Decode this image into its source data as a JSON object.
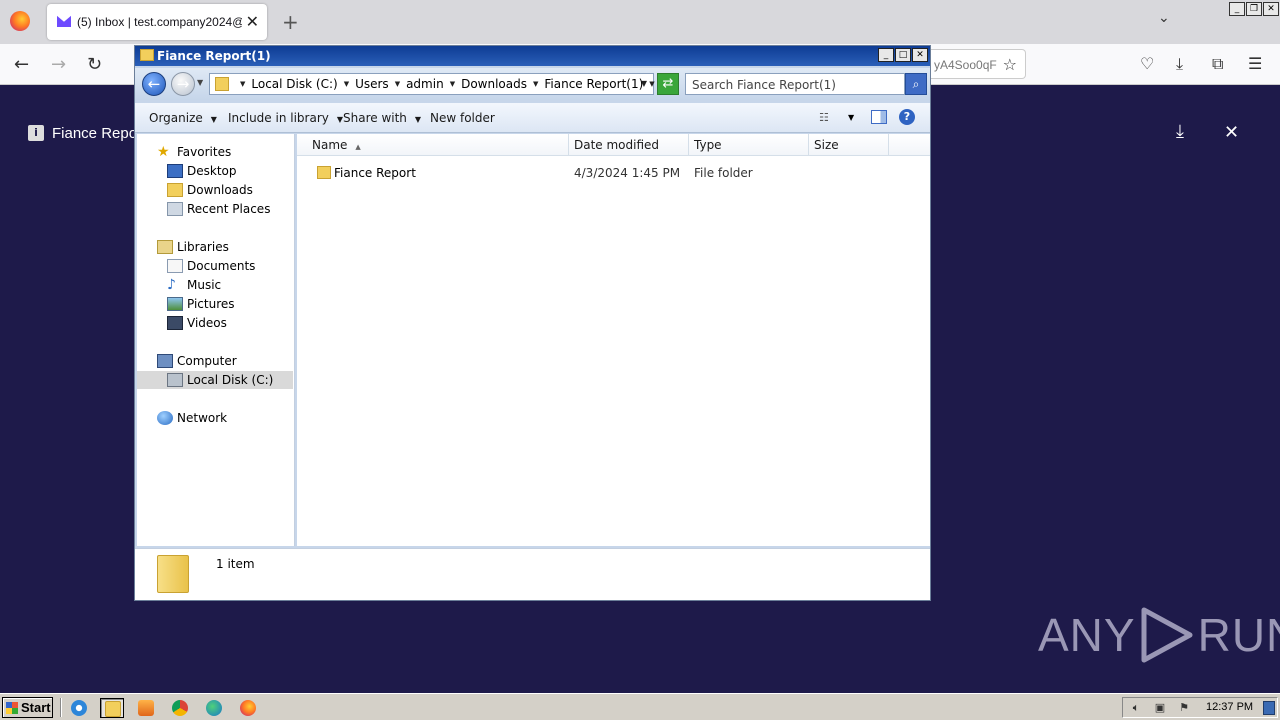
{
  "browser": {
    "tab_title": "(5) Inbox | test.company2024@pr",
    "url_fragment": "yA4Soo0qF",
    "page_header_title": "Fiance Repo"
  },
  "explorer": {
    "window_title": "Fiance Report(1)",
    "breadcrumb": [
      "Local Disk (C:)",
      "Users",
      "admin",
      "Downloads",
      "Fiance Report(1)"
    ],
    "search_placeholder": "Search Fiance Report(1)",
    "toolbar": {
      "organize": "Organize",
      "include_in_library": "Include in library",
      "share_with": "Share with",
      "new_folder": "New folder"
    },
    "nav": {
      "favorites": "Favorites",
      "desktop": "Desktop",
      "downloads": "Downloads",
      "recent_places": "Recent Places",
      "libraries": "Libraries",
      "documents": "Documents",
      "music": "Music",
      "pictures": "Pictures",
      "videos": "Videos",
      "computer": "Computer",
      "local_disk": "Local Disk (C:)",
      "network": "Network"
    },
    "columns": {
      "name": "Name",
      "date_modified": "Date modified",
      "type": "Type",
      "size": "Size"
    },
    "files": [
      {
        "name": "Fiance Report",
        "date_modified": "4/3/2024 1:45 PM",
        "type": "File folder",
        "size": ""
      }
    ],
    "details_count": "1 item"
  },
  "taskbar": {
    "start_label": "Start",
    "clock": "12:37 PM"
  },
  "watermark": {
    "left": "ANY",
    "right": "RUN"
  }
}
